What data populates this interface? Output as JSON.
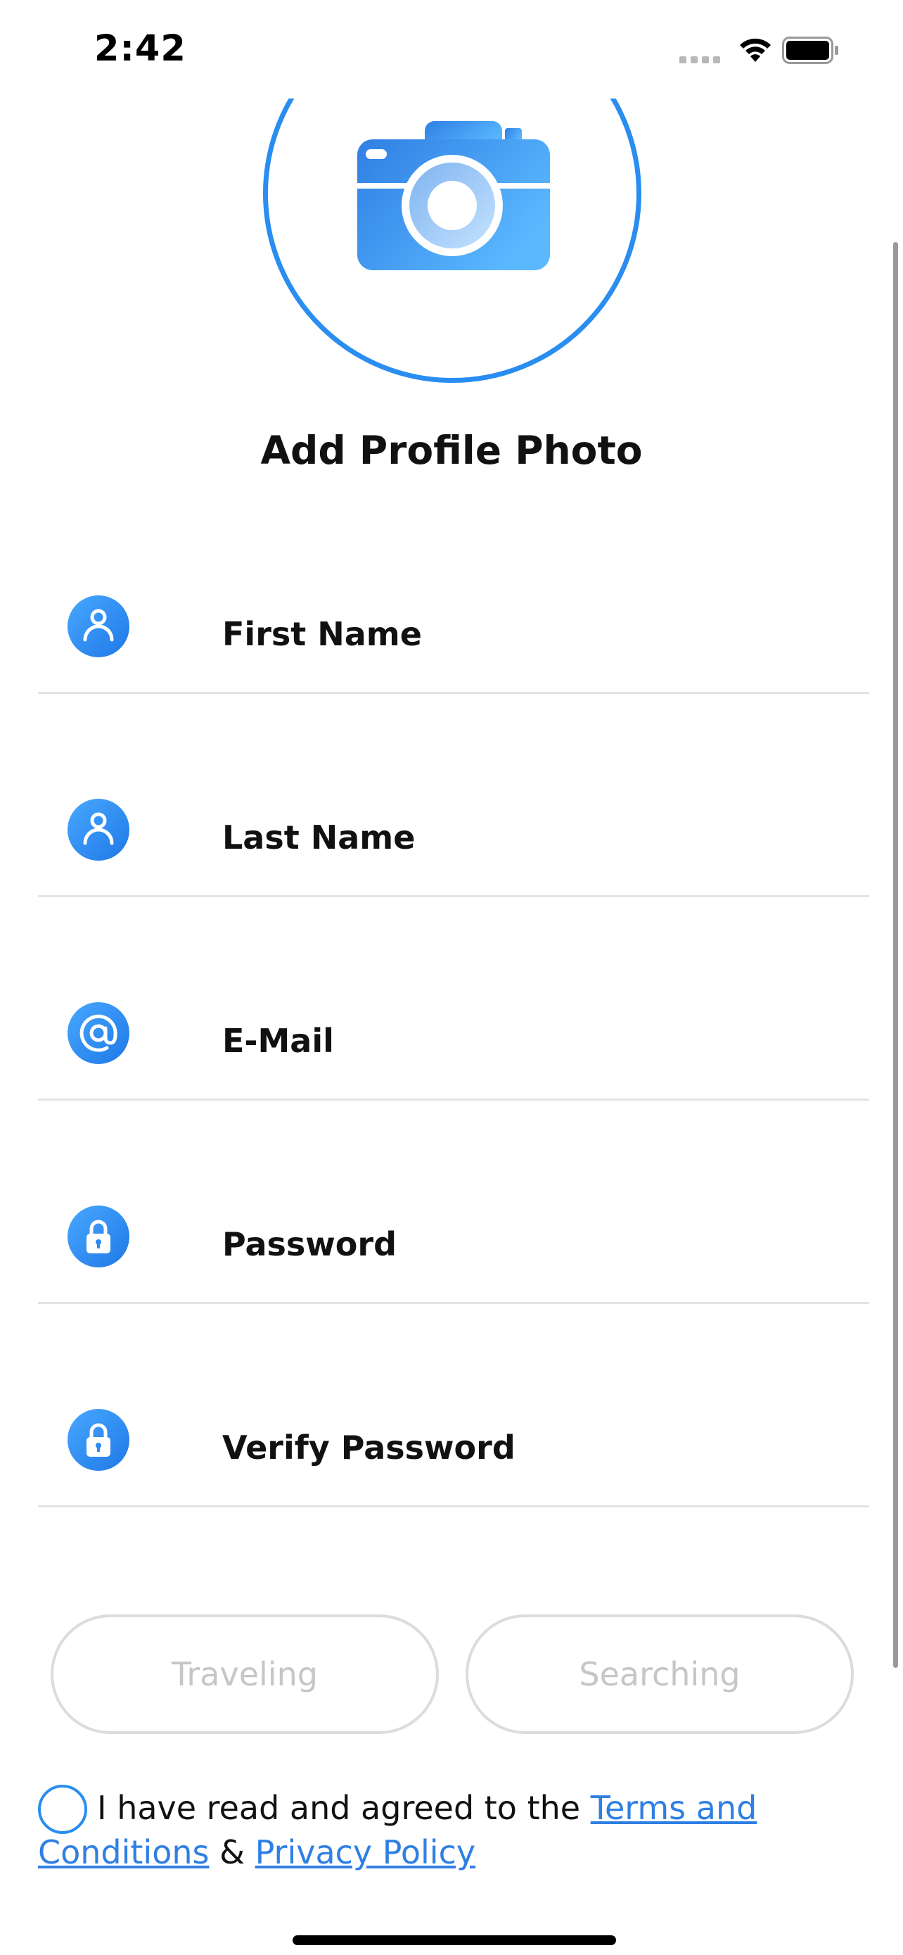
{
  "status_bar": {
    "time": "2:42"
  },
  "profile_photo": {
    "title": "Add Profile Photo",
    "icon": "camera-icon"
  },
  "form": {
    "fields": [
      {
        "label": "First Name",
        "icon": "person-icon"
      },
      {
        "label": "Last Name",
        "icon": "person-icon"
      },
      {
        "label": "E-Mail",
        "icon": "at-sign-icon"
      },
      {
        "label": "Password",
        "icon": "lock-icon"
      },
      {
        "label": "Verify Password",
        "icon": "lock-icon"
      }
    ]
  },
  "role_options": {
    "traveling": "Traveling",
    "searching": "Searching"
  },
  "terms": {
    "prefix": "I have read and agreed to the ",
    "terms_link": "Terms and Conditions",
    "separator": " & ",
    "privacy_link": "Privacy Policy"
  },
  "colors": {
    "accent": "#2a8df0",
    "link": "#2f7fe3",
    "disabled_text": "#c6c6c6",
    "divider": "#e3e3e3"
  }
}
